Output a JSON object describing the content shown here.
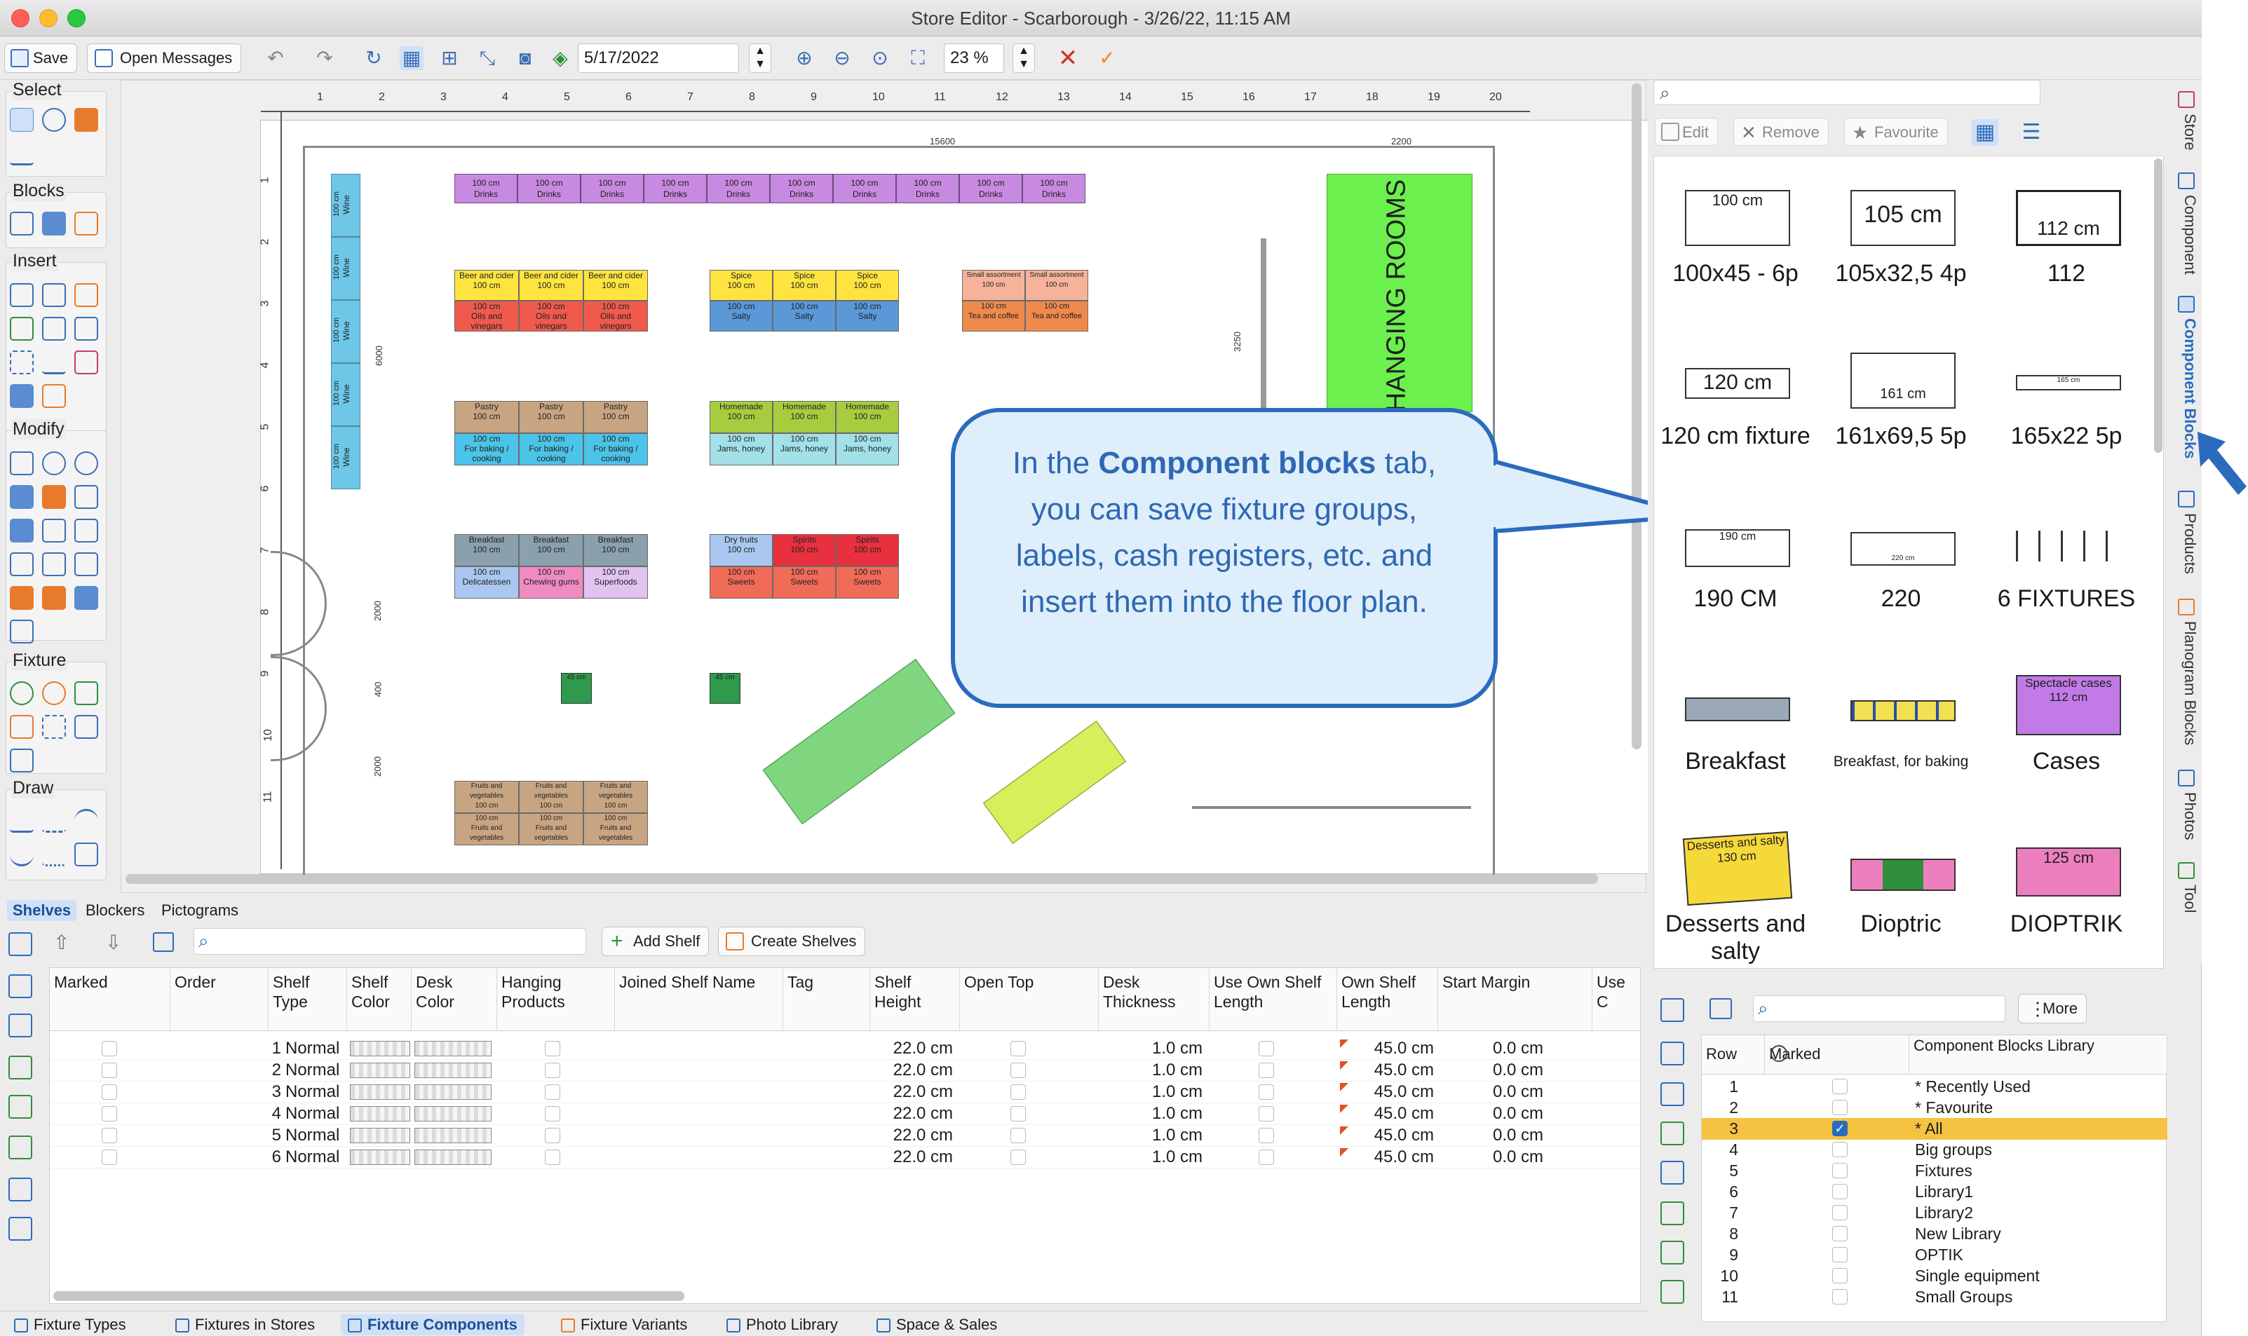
{
  "window": {
    "title": "Store Editor - Scarborough - 3/26/22, 11:15 AM"
  },
  "toolbar": {
    "save_label": "Save",
    "open_messages_label": "Open Messages",
    "date": "5/17/2022",
    "zoom": "23 %"
  },
  "palette": {
    "select": "Select",
    "blocks": "Blocks",
    "insert": "Insert",
    "modify": "Modify",
    "fixture": "Fixture",
    "draw": "Draw"
  },
  "floor": {
    "hanging_rooms": "HANGING ROOMS",
    "ruler_top": [
      "1",
      "2",
      "3",
      "4",
      "5",
      "6",
      "7",
      "8",
      "9",
      "10",
      "11",
      "12",
      "13",
      "14",
      "15",
      "16",
      "17",
      "18",
      "19",
      "20"
    ],
    "ruler_left": [
      "1",
      "2",
      "3",
      "4",
      "5",
      "6",
      "7",
      "8",
      "9",
      "10",
      "11"
    ],
    "dim_15600": "15600",
    "dim_2200": "2200",
    "dim_6000": "6000",
    "dim_3250": "3250",
    "dim_2000": "2000",
    "dim_2000b": "2000",
    "dim_400": "400",
    "drinks_top": "100 cm",
    "drinks_bottom": "Drinks",
    "wine": "Wine",
    "wine_cm": "100 cm"
  },
  "callout": {
    "pre": "In the ",
    "bold": "Component blocks",
    "post": " tab, you can save fixture groups, labels, cash registers, etc. and insert them into the floor plan."
  },
  "component_panel": {
    "edit_label": "Edit",
    "remove_label": "Remove",
    "favourite_label": "Favourite",
    "items": [
      {
        "thumb": "100 cm",
        "label": "100x45 - 6p"
      },
      {
        "thumb": "105 cm",
        "label": "105x32,5 4p"
      },
      {
        "thumb": "112 cm",
        "label": "112"
      },
      {
        "thumb": "120 cm",
        "label": "120 cm fixture"
      },
      {
        "thumb": "161 cm",
        "label": "161x69,5 5p"
      },
      {
        "thumb": "165 cm",
        "label": "165x22 5p"
      },
      {
        "thumb": "190 cm",
        "label": "190 CM"
      },
      {
        "thumb": "220 cm",
        "label": "220"
      },
      {
        "thumb": "",
        "label": "6 FIXTURES"
      },
      {
        "thumb": "",
        "label": "Breakfast"
      },
      {
        "thumb": "",
        "label": "Breakfast, for baking"
      },
      {
        "thumb": "Spectacle cases 112 cm",
        "label": "Cases"
      },
      {
        "thumb": "Desserts and salty 130 cm",
        "label": "Desserts and salty"
      },
      {
        "thumb": "",
        "label": "Dioptric"
      },
      {
        "thumb": "125 cm",
        "label": "DIOPTRIK"
      }
    ]
  },
  "vtabs": [
    "Store",
    "Component",
    "Component Blocks",
    "Products",
    "Planogram Blocks",
    "Photos",
    "Tool"
  ],
  "shelves_panel": {
    "tabs": [
      "Shelves",
      "Blockers",
      "Pictograms"
    ],
    "add_shelf_label": "Add Shelf",
    "create_shelves_label": "Create Shelves",
    "columns": [
      "Marked",
      "Order",
      "Shelf Type",
      "Shelf Color",
      "Desk Color",
      "Hanging Products",
      "Joined Shelf Name",
      "Tag",
      "Shelf Height",
      "Open Top",
      "Desk Thickness",
      "Use Own Shelf Length",
      "Own Shelf Length",
      "Start Margin",
      "Use C"
    ],
    "rows": [
      {
        "order": "1",
        "type": "Normal",
        "height": "22.0 cm",
        "thickness": "1.0 cm",
        "length": "45.0 cm",
        "margin": "0.0 cm"
      },
      {
        "order": "2",
        "type": "Normal",
        "height": "22.0 cm",
        "thickness": "1.0 cm",
        "length": "45.0 cm",
        "margin": "0.0 cm"
      },
      {
        "order": "3",
        "type": "Normal",
        "height": "22.0 cm",
        "thickness": "1.0 cm",
        "length": "45.0 cm",
        "margin": "0.0 cm"
      },
      {
        "order": "4",
        "type": "Normal",
        "height": "22.0 cm",
        "thickness": "1.0 cm",
        "length": "45.0 cm",
        "margin": "0.0 cm"
      },
      {
        "order": "5",
        "type": "Normal",
        "height": "22.0 cm",
        "thickness": "1.0 cm",
        "length": "45.0 cm",
        "margin": "0.0 cm"
      },
      {
        "order": "6",
        "type": "Normal",
        "height": "22.0 cm",
        "thickness": "1.0 cm",
        "length": "45.0 cm",
        "margin": "0.0 cm"
      }
    ]
  },
  "library_panel": {
    "more_label": "More",
    "columns": [
      "Row",
      "Marked",
      "Component Blocks Library"
    ],
    "rows": [
      {
        "row": "1",
        "name": "* Recently Used"
      },
      {
        "row": "2",
        "name": "* Favourite"
      },
      {
        "row": "3",
        "name": "* All"
      },
      {
        "row": "4",
        "name": "Big groups"
      },
      {
        "row": "5",
        "name": "Fixtures"
      },
      {
        "row": "6",
        "name": "Library1"
      },
      {
        "row": "7",
        "name": "Library2"
      },
      {
        "row": "8",
        "name": "New Library"
      },
      {
        "row": "9",
        "name": "OPTIK"
      },
      {
        "row": "10",
        "name": "Single equipment"
      },
      {
        "row": "11",
        "name": "Small Groups"
      }
    ],
    "selected_color": "#f5c242"
  },
  "footer_tabs": [
    "Fixture Types",
    "Fixtures in Stores",
    "Fixture Components",
    "Fixture Variants",
    "Photo Library",
    "Space & Sales"
  ]
}
